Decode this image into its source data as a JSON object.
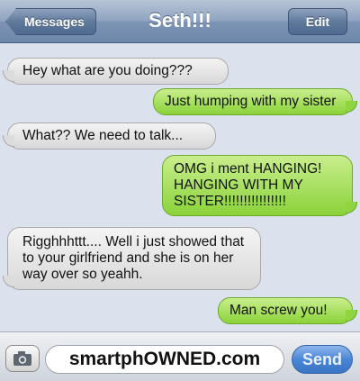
{
  "header": {
    "back_label": "Messages",
    "title": "Seth!!!",
    "edit_label": "Edit"
  },
  "messages": [
    {
      "direction": "received",
      "text": "Hey what are you doing???"
    },
    {
      "direction": "sent",
      "text": "Just humping with my sister"
    },
    {
      "direction": "received",
      "text": "What?? We need to talk..."
    },
    {
      "direction": "sent",
      "text": "OMG i ment HANGING! HANGING WITH MY SISTER!!!!!!!!!!!!!!!!"
    },
    {
      "direction": "received",
      "text": "Rigghhhttt.... Well i just showed that to your girlfriend and she is on her way over so yeahh."
    },
    {
      "direction": "sent",
      "text": "Man screw you!"
    }
  ],
  "input": {
    "value": "smartphOWNED.com",
    "send_label": "Send",
    "camera_icon": "camera-icon"
  },
  "colors": {
    "sent_bubble": "#8ad33a",
    "received_bubble": "#e2e2e2",
    "navbar": "#7d94b5",
    "background": "#dbe2ed",
    "send_button": "#4a86d6"
  }
}
